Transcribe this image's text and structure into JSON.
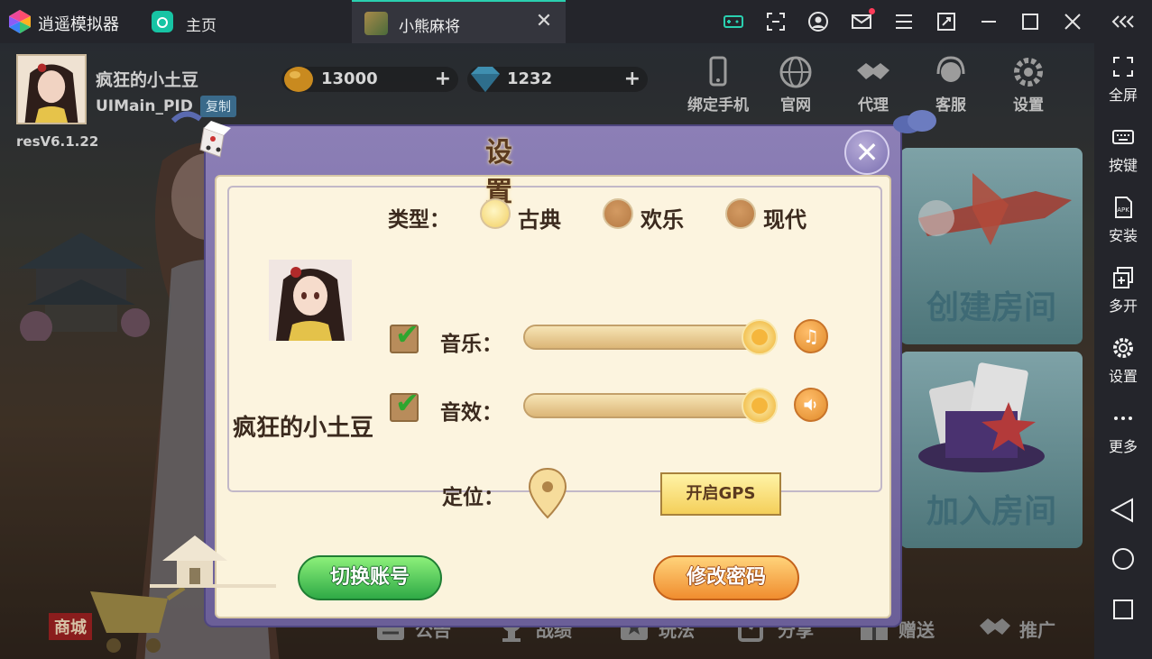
{
  "titlebar": {
    "app_name": "逍遥模拟器",
    "home_label": "主页",
    "active_tab_label": "小熊麻将",
    "tab_close": "✕",
    "icons": [
      "gamepad-icon",
      "screenshot-icon",
      "account-icon",
      "mail-icon",
      "menu-icon",
      "screen-rotate-icon",
      "minimize-icon",
      "maximize-icon",
      "close-icon",
      "collapse-icon"
    ]
  },
  "sidebar": {
    "items": [
      {
        "label": "全屏",
        "icon": "fullscreen-icon"
      },
      {
        "label": "按键",
        "icon": "keyboard-icon"
      },
      {
        "label": "安装",
        "icon": "apk-icon"
      },
      {
        "label": "多开",
        "icon": "multi-instance-icon"
      },
      {
        "label": "设置",
        "icon": "gear-icon"
      },
      {
        "label": "更多",
        "icon": "more-icon"
      }
    ],
    "nav": [
      "back-icon",
      "home-circle-icon",
      "recents-icon"
    ]
  },
  "hud": {
    "player_name": "疯狂的小土豆",
    "player_id": "UIMain_PID",
    "copy_label": "复制",
    "version": "resV6.1.22",
    "gold": "13000",
    "diamond": "1232",
    "top_buttons": [
      {
        "label": "绑定手机",
        "icon": "phone-icon"
      },
      {
        "label": "官网",
        "icon": "globe-icon"
      },
      {
        "label": "代理",
        "icon": "handshake-icon"
      },
      {
        "label": "客服",
        "icon": "headset-icon"
      },
      {
        "label": "设置",
        "icon": "gear-icon"
      }
    ],
    "create_room": "创建房间",
    "join_room": "加入房间",
    "shop": "商城",
    "bottom_menu": [
      {
        "label": "公告",
        "icon": "notice-icon"
      },
      {
        "label": "战绩",
        "icon": "trophy-icon"
      },
      {
        "label": "玩法",
        "icon": "book-icon"
      },
      {
        "label": "分享",
        "icon": "share-icon"
      },
      {
        "label": "赠送",
        "icon": "gift-icon"
      },
      {
        "label": "推广",
        "icon": "promote-icon"
      }
    ]
  },
  "settings": {
    "title": "设置",
    "type_label": "类型：",
    "themes": [
      {
        "label": "古典",
        "selected": true
      },
      {
        "label": "欢乐",
        "selected": false
      },
      {
        "label": "现代",
        "selected": false
      }
    ],
    "user_name": "疯狂的小土豆",
    "music_label": "音乐：",
    "music_enabled": true,
    "music_level": 1.0,
    "sound_label": "音效：",
    "sound_enabled": true,
    "sound_level": 1.0,
    "location_label": "定位：",
    "gps_button": "开启GPS",
    "switch_account": "切换账号",
    "change_password": "修改密码",
    "colors": {
      "accent_purple": "#7a6fb0",
      "panel_cream": "#fbf3dc",
      "green_button": "#2faa46",
      "orange_button": "#f08d2f"
    }
  }
}
